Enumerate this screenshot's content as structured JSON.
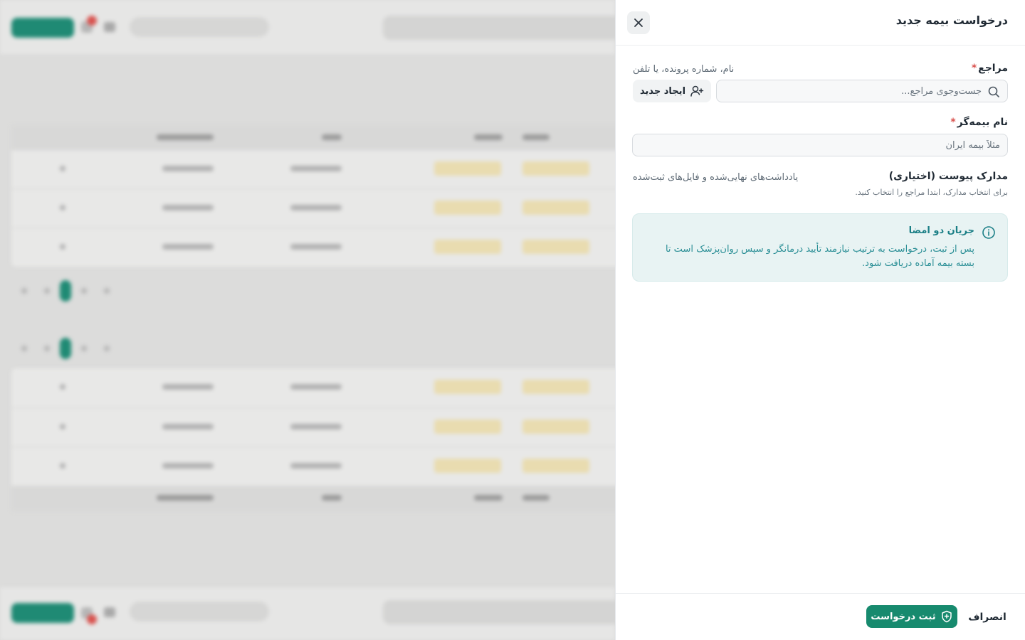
{
  "drawer": {
    "title": "درخواست بیمه جدید",
    "close_icon": "close-icon"
  },
  "client_field": {
    "label": "مراجع",
    "required_mark": "*",
    "hint": "نام، شماره پرونده، یا تلفن",
    "search_placeholder": "جست‌وجوی مراجع...",
    "search_icon": "search-icon",
    "create_button_label": "ایجاد جدید",
    "create_icon": "user-plus-icon"
  },
  "insurer_field": {
    "label": "نام بیمه‌گر",
    "required_mark": "*",
    "placeholder": "مثلاً بیمه ایران"
  },
  "attachments_field": {
    "label": "مدارک پیوست (اختیاری)",
    "hint": "یادداشت‌های نهایی‌شده و فایل‌های ثبت‌شده",
    "sub_hint": "برای انتخاب مدارک، ابتدا مراجع را انتخاب کنید."
  },
  "info_box": {
    "icon": "info-icon",
    "title": "جریان دو امضا",
    "body": "پس از ثبت، درخواست به ترتیب نیازمند تأیید درمانگر و سپس روان‌پزشک است تا بسته بیمه آماده دریافت شود."
  },
  "footer": {
    "cancel_label": "انصراف",
    "submit_label": "ثبت درخواست",
    "submit_icon": "shield-icon"
  },
  "colors": {
    "primary": "#178a6e",
    "info_bg": "#e8f3f3",
    "info_text": "#1b7f86",
    "required": "#d9534f"
  }
}
